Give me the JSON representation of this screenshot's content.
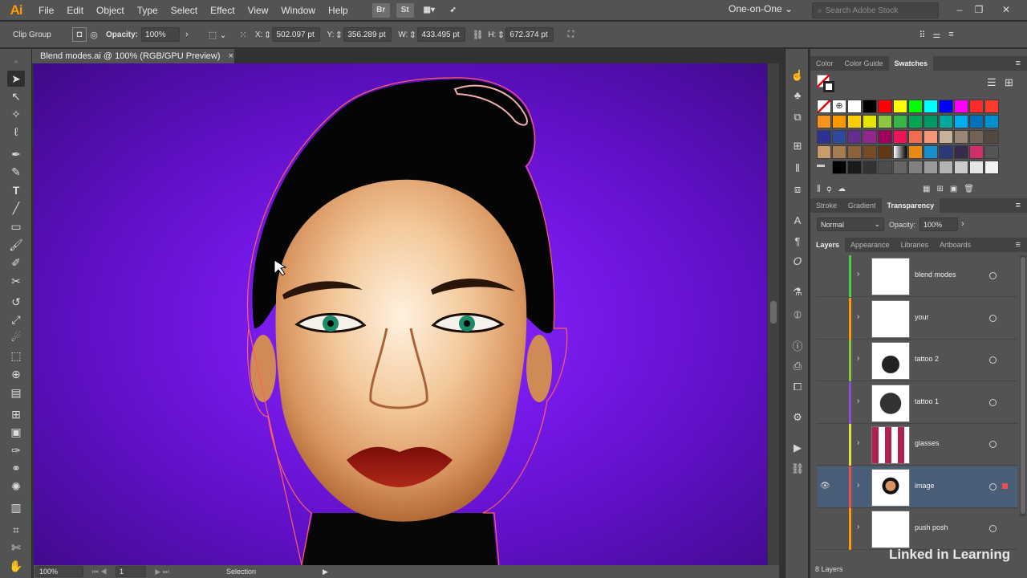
{
  "app": {
    "logo": "Ai",
    "title": "Adobe Illustrator"
  },
  "menubar": {
    "items": [
      "File",
      "Edit",
      "Object",
      "Type",
      "Select",
      "Effect",
      "View",
      "Window",
      "Help"
    ],
    "bridge_icon": "Br",
    "stock_icon": "St",
    "workspace": "One-on-One",
    "search_placeholder": "Search Adobe Stock"
  },
  "controlbar": {
    "selection_type": "Clip Group",
    "opacity_label": "Opacity:",
    "opacity_value": "100%",
    "x_label": "X:",
    "x_value": "502.097 pt",
    "y_label": "Y:",
    "y_value": "356.289 pt",
    "w_label": "W:",
    "w_value": "433.495 pt",
    "h_label": "H:",
    "h_value": "672.374 pt"
  },
  "document": {
    "tab_title": "Blend modes.ai @ 100% (RGB/GPU Preview)",
    "close_glyph": "×"
  },
  "statusbar": {
    "zoom": "100%",
    "artboard": "1",
    "status_text": "Selection"
  },
  "panels": {
    "swatch_tabs": [
      "Color",
      "Color Guide",
      "Swatches"
    ],
    "swatch_active": "Swatches",
    "transparency_tabs": [
      "Stroke",
      "Gradient",
      "Transparency"
    ],
    "transparency_active": "Transparency",
    "blend_mode": "Normal",
    "opacity_label": "Opacity:",
    "opacity_value": "100%",
    "layer_tabs": [
      "Layers",
      "Appearance",
      "Libraries",
      "Artboards"
    ],
    "layer_active": "Layers",
    "layer_count": "8 Layers",
    "layers": [
      {
        "name": "blend modes",
        "color": "#4dcc4d",
        "selected": false
      },
      {
        "name": "your",
        "color": "#ff9a00",
        "selected": false
      },
      {
        "name": "tattoo 2",
        "color": "#88c840",
        "selected": false
      },
      {
        "name": "tattoo 1",
        "color": "#8a4ed8",
        "selected": false
      },
      {
        "name": "glasses",
        "color": "#e8e040",
        "selected": false
      },
      {
        "name": "image",
        "color": "#e85050",
        "selected": true
      },
      {
        "name": "push posh",
        "color": "#ff9a00",
        "selected": false
      }
    ]
  },
  "swatch_colors": [
    [
      "none",
      "reg",
      "#ffffff",
      "#000000",
      "#ff0000",
      "#ffff00",
      "#00ff00",
      "#00ffff",
      "#0000ff",
      "#ff00ff",
      "#ff2b2b",
      "#ff3b2b"
    ],
    [
      "#f7941d",
      "#ff9900",
      "#ffcc00",
      "#e5e500",
      "#8dc63f",
      "#39b54a",
      "#00a651",
      "#009966",
      "#00a99d",
      "#00aeef",
      "#0072bc",
      "#0090d0"
    ],
    [
      "#2e3192",
      "#2e4a9e",
      "#662d91",
      "#92278f",
      "#9e005d",
      "#ed145b",
      "#f26c4f",
      "#f69679",
      "#c7b299",
      "#998675",
      "#736357",
      "#534741"
    ],
    [
      "#c69c6d",
      "#a67c52",
      "#8c6239",
      "#754c24",
      "#603913",
      "#ffffff-black",
      "#e88a10",
      "#1a8fcc",
      "#2b3a7a",
      "#3a2a4a",
      "#d0306a",
      "#555555"
    ],
    [
      "folder",
      "#000000",
      "#1a1a1a",
      "#333333",
      "#4d4d4d",
      "#666666",
      "#808080",
      "#999999",
      "#b3b3b3",
      "#cccccc",
      "#e6e6e6",
      "#f2f2f2"
    ]
  ],
  "watermark": "Linked in Learning"
}
